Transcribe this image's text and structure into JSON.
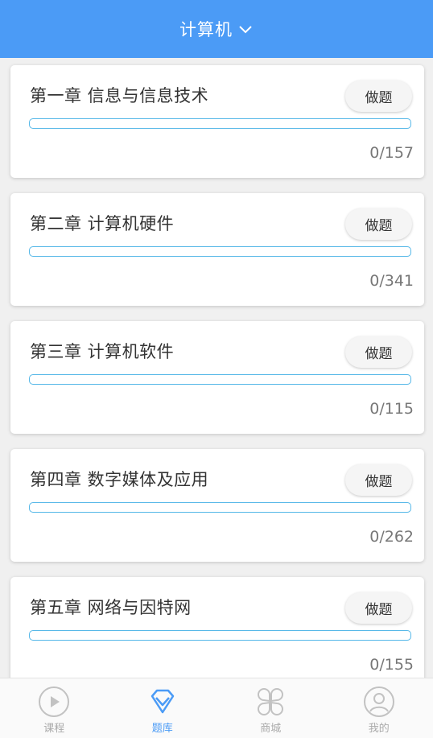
{
  "header": {
    "title": "计算机"
  },
  "chapters": [
    {
      "title": "第一章 信息与信息技术",
      "button": "做题",
      "done": 0,
      "total": 157,
      "count": "0/157"
    },
    {
      "title": "第二章 计算机硬件",
      "button": "做题",
      "done": 0,
      "total": 341,
      "count": "0/341"
    },
    {
      "title": "第三章 计算机软件",
      "button": "做题",
      "done": 0,
      "total": 115,
      "count": "0/115"
    },
    {
      "title": "第四章 数字媒体及应用",
      "button": "做题",
      "done": 0,
      "total": 262,
      "count": "0/262"
    },
    {
      "title": "第五章 网络与因特网",
      "button": "做题",
      "done": 0,
      "total": 155,
      "count": "0/155"
    }
  ],
  "tabs": [
    {
      "label": "课程",
      "icon": "play-circle-icon"
    },
    {
      "label": "题库",
      "icon": "diamond-icon",
      "active": true
    },
    {
      "label": "商城",
      "icon": "clover-icon"
    },
    {
      "label": "我的",
      "icon": "user-icon"
    }
  ],
  "colors": {
    "header": "#4b9bf6",
    "progress": "#56b8e8",
    "tab_active": "#4b9bf6",
    "tab_inactive": "#aaaaaa"
  }
}
